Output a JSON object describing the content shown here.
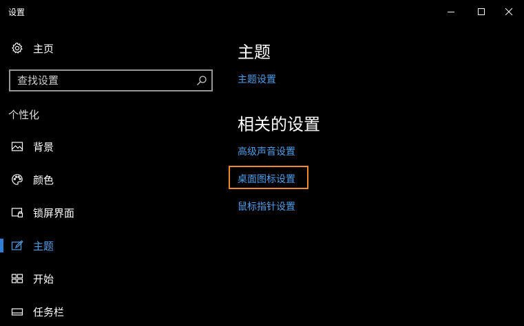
{
  "window": {
    "title": "设置"
  },
  "sidebar": {
    "home": {
      "label": "主页",
      "icon": "gear-icon"
    },
    "search": {
      "placeholder": "查找设置",
      "value": "",
      "icon": "search-icon"
    },
    "section_label": "个性化",
    "items": [
      {
        "label": "背景",
        "icon": "image-icon",
        "active": false
      },
      {
        "label": "颜色",
        "icon": "palette-icon",
        "active": false
      },
      {
        "label": "锁屏界面",
        "icon": "lockscreen-icon",
        "active": false
      },
      {
        "label": "主题",
        "icon": "theme-icon",
        "active": true
      },
      {
        "label": "开始",
        "icon": "start-icon",
        "active": false
      },
      {
        "label": "任务栏",
        "icon": "taskbar-icon",
        "active": false
      }
    ]
  },
  "main": {
    "heading": "主题",
    "theme_link": "主题设置",
    "related_heading": "相关的设置",
    "related_links": [
      "高级声音设置",
      "桌面图标设置",
      "鼠标指针设置"
    ],
    "highlighted_link_index": 1
  },
  "colors": {
    "background": "#000000",
    "accent": "#4f9ee8",
    "highlight": "#f08a2a"
  }
}
